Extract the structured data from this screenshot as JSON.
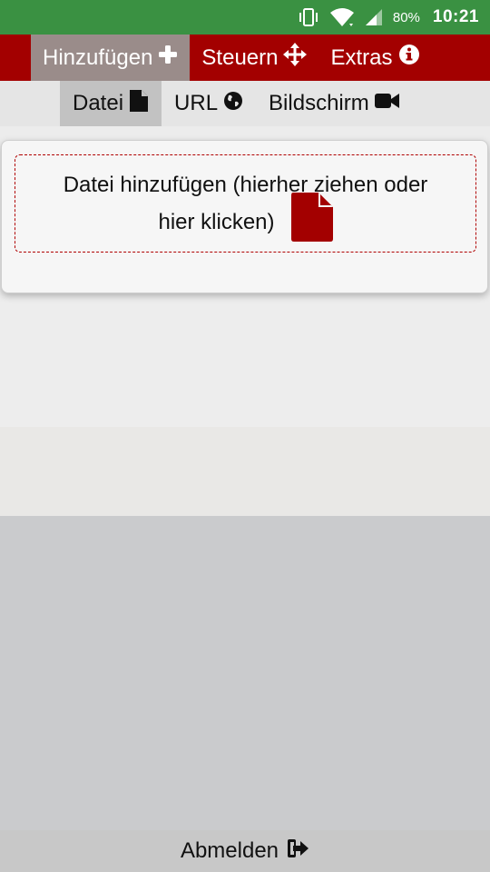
{
  "status_bar": {
    "battery": "80%",
    "time": "10:21",
    "icons": [
      "vibrate-icon",
      "wifi-icon",
      "signal-icon"
    ]
  },
  "main_nav": {
    "items": [
      {
        "label": "Hinzufügen",
        "icon": "plus-icon",
        "active": true
      },
      {
        "label": "Steuern",
        "icon": "move-arrows-icon",
        "active": false
      },
      {
        "label": "Extras",
        "icon": "info-circle-icon",
        "active": false
      }
    ]
  },
  "sub_nav": {
    "items": [
      {
        "label": "Datei",
        "icon": "file-icon",
        "active": true
      },
      {
        "label": "URL",
        "icon": "globe-icon",
        "active": false
      },
      {
        "label": "Bildschirm",
        "icon": "video-camera-icon",
        "active": false
      }
    ]
  },
  "dropzone": {
    "line1": "Datei hinzufügen (hierher ziehen oder",
    "line2": "hier klicken)",
    "icon": "file-icon"
  },
  "footer": {
    "logout_label": "Abmelden",
    "icon": "sign-out-icon"
  },
  "colors": {
    "status_bar": "#3a9142",
    "nav_bar": "#a30000",
    "nav_active": "#9a8c8a",
    "subnav_bar": "#e5e5e5",
    "subnav_active": "#c2c2c2",
    "accent": "#a30000"
  }
}
